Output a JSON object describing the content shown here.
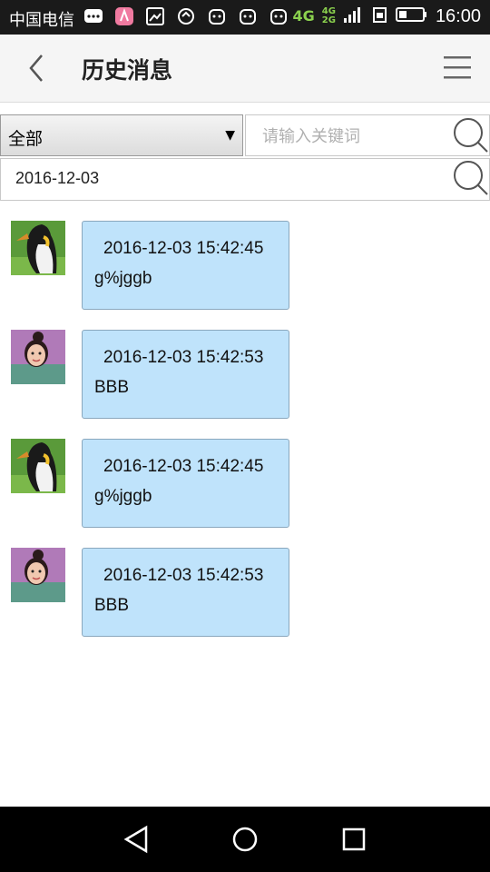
{
  "status_bar": {
    "carrier": "中国电信",
    "network_main": "4G",
    "network_sub1": "4G",
    "network_sub2": "2G",
    "time": "16:00",
    "icons": [
      "chat-icon",
      "app-icon",
      "image-icon",
      "sync-icon",
      "cat-icon",
      "cat-icon",
      "cat-icon",
      "signal-icon",
      "sim-icon",
      "battery-icon"
    ]
  },
  "header": {
    "title": "历史消息",
    "back_icon": "chevron-left-icon",
    "menu_icon": "hamburger-icon"
  },
  "filters": {
    "category_selected": "全部",
    "keyword_placeholder": "请输入关键词",
    "keyword_value": "",
    "date_value": "2016-12-03"
  },
  "messages": [
    {
      "avatar": "penguin-avatar",
      "time": "2016-12-03 15:42:45",
      "text": "g%jggb"
    },
    {
      "avatar": "girl-avatar",
      "time": "2016-12-03 15:42:53",
      "text": "BBB"
    },
    {
      "avatar": "penguin-avatar",
      "time": "2016-12-03 15:42:45",
      "text": "g%jggb"
    },
    {
      "avatar": "girl-avatar",
      "time": "2016-12-03 15:42:53",
      "text": "BBB"
    }
  ],
  "colors": {
    "bubble": "#bfe3fb",
    "bubble_border": "#8aa7bd",
    "network_green": "#8bd14e",
    "header_bg": "#f5f5f5"
  }
}
